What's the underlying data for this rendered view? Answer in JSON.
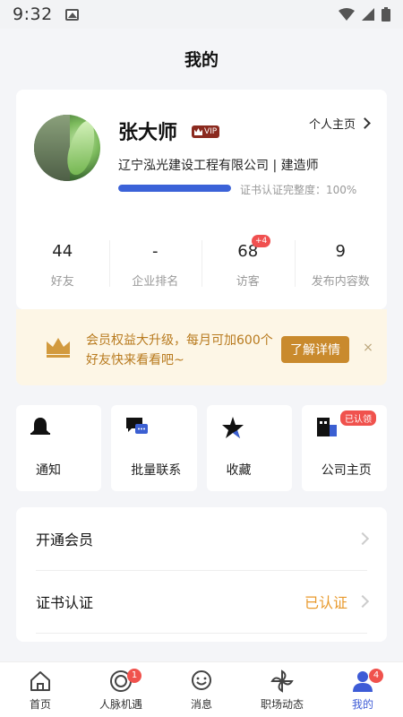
{
  "status_bar": {
    "time": "9:32"
  },
  "header": {
    "title": "我的"
  },
  "profile": {
    "name": "张大师",
    "vip_label": "VIP",
    "homepage_link": "个人主页",
    "company": "辽宁泓光建设工程有限公司 | 建造师",
    "cert_progress_percent": 100,
    "cert_progress_text": "证书认证完整度：100%"
  },
  "stats": [
    {
      "value": "44",
      "label": "好友",
      "badge": ""
    },
    {
      "value": "-",
      "label": "企业排名",
      "badge": ""
    },
    {
      "value": "68",
      "label": "访客",
      "badge": "+4"
    },
    {
      "value": "9",
      "label": "发布内容数",
      "badge": ""
    }
  ],
  "promo": {
    "text": "会员权益大升级，每月可加600个好友快来看看吧~",
    "button": "了解详情",
    "close": "×"
  },
  "quick_actions": [
    {
      "label": "通知",
      "icon": "bell-icon",
      "tag": ""
    },
    {
      "label": "批量联系",
      "icon": "chat-icon",
      "tag": ""
    },
    {
      "label": "收藏",
      "icon": "star-icon",
      "tag": ""
    },
    {
      "label": "公司主页",
      "icon": "building-icon",
      "tag": "已认领"
    }
  ],
  "menu": [
    {
      "label": "开通会员",
      "status": ""
    },
    {
      "label": "证书认证",
      "status": "已认证"
    }
  ],
  "tabs": [
    {
      "label": "首页",
      "icon": "home-icon",
      "badge": "",
      "active": false
    },
    {
      "label": "人脉机遇",
      "icon": "compass-icon",
      "badge": "1",
      "active": false
    },
    {
      "label": "消息",
      "icon": "message-icon",
      "badge": "",
      "active": false
    },
    {
      "label": "职场动态",
      "icon": "pinwheel-icon",
      "badge": "",
      "active": false
    },
    {
      "label": "我的",
      "icon": "person-icon",
      "badge": "4",
      "active": true
    }
  ],
  "colors": {
    "accent": "#3d5bd6",
    "promo_gold": "#c98a2d",
    "badge_red": "#f0524d",
    "verified_orange": "#e8992b"
  }
}
